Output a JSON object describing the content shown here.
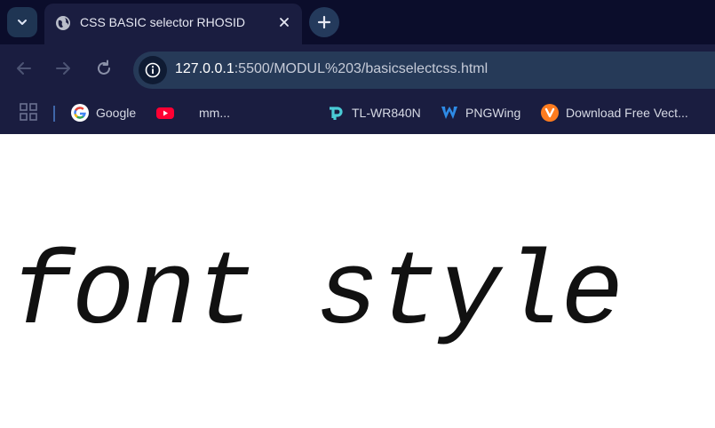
{
  "browser": {
    "tab": {
      "title": "CSS BASIC selector RHOSID"
    },
    "address_bar": {
      "url_host": "127.0.0.1",
      "url_rest": ":5500/MODUL%203/basicselectcss.html"
    },
    "bookmarks": [
      {
        "label": "Google",
        "icon": "google-icon"
      },
      {
        "label": "",
        "icon": "youtube-icon"
      },
      {
        "label": "mm...",
        "icon": "blank-icon"
      },
      {
        "label": "TL-WR840N",
        "icon": "tp-link-icon"
      },
      {
        "label": "PNGWing",
        "icon": "pngwing-icon"
      },
      {
        "label": "Download Free Vect...",
        "icon": "vecteezy-icon"
      }
    ]
  },
  "page": {
    "heading": "font style"
  },
  "colors": {
    "tab_strip": "#0b0d2b",
    "toolbar": "#1a1d40",
    "omnibox": "#263a58",
    "page_bg": "#ffffff",
    "text": "#111111"
  }
}
